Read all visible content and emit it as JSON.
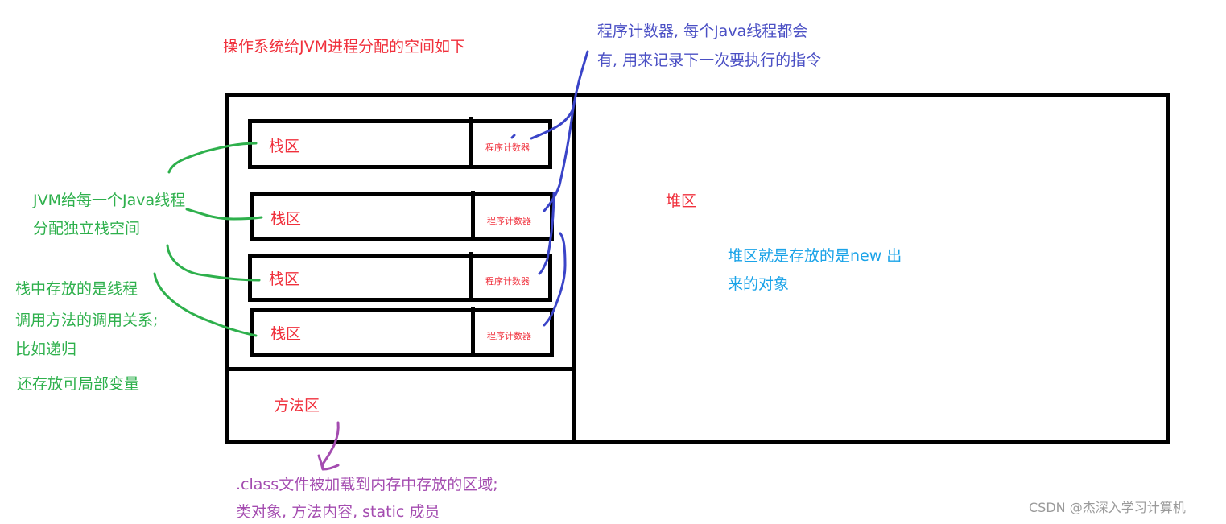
{
  "title": "操作系统给JVM进程分配的空间如下",
  "pc_note": {
    "line1": "程序计数器, 每个Java线程都会",
    "line2": "有, 用来记录下一次要执行的指令"
  },
  "stack_frames": [
    {
      "stack_label": "栈区",
      "pc_label": "程序计数器"
    },
    {
      "stack_label": "栈区",
      "pc_label": "程序计数器"
    },
    {
      "stack_label": "栈区",
      "pc_label": "程序计数器"
    },
    {
      "stack_label": "栈区",
      "pc_label": "程序计数器"
    }
  ],
  "method_area": {
    "label": "方法区"
  },
  "heap": {
    "label": "堆区",
    "note_line1": "堆区就是存放的是new 出",
    "note_line2": "来的对象"
  },
  "left_notes": {
    "thread_stack_line1": "JVM给每一个Java线程",
    "thread_stack_line2": "分配独立栈空间",
    "stack_content_line1": "栈中存放的是线程",
    "stack_content_line2": "调用方法的调用关系;",
    "stack_content_line3": "比如递归",
    "local_vars": "还存放可局部变量"
  },
  "method_area_note": {
    "line1": ".class文件被加载到内存中存放的区域;",
    "line2": "类对象, 方法内容, static 成员"
  },
  "watermark": "CSDN @杰深入学习计算机",
  "colors": {
    "region_label": "#f0303c",
    "pc_annotation": "#4a4fc4",
    "stack_annotation": "#2eb04c",
    "heap_annotation": "#1aa3e8",
    "method_annotation": "#a44cb0"
  }
}
